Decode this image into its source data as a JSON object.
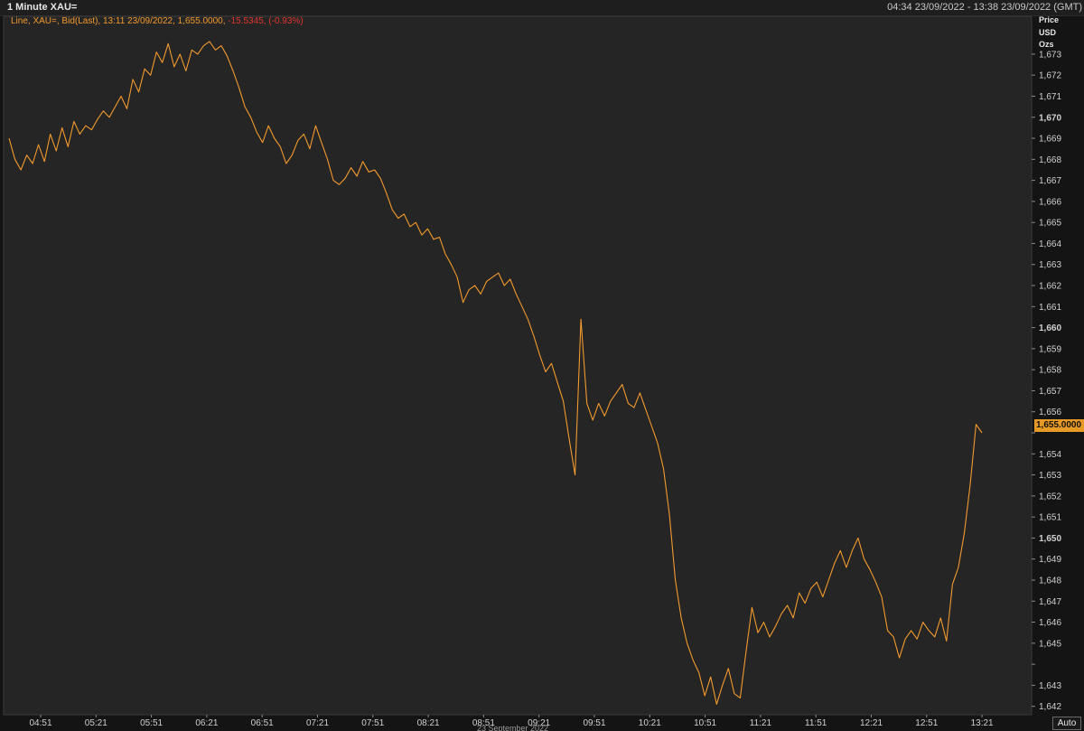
{
  "window": {
    "title": "1 Minute XAU=",
    "time_range": "04:34 23/09/2022 - 13:38 23/09/2022 (GMT)"
  },
  "legend": {
    "main": "Line, XAU=, Bid(Last),  13:11 23/09/2022, 1,655.0000, ",
    "change": "-15.5345, (-0.93%)"
  },
  "axis": {
    "title_lines": [
      "Price",
      "USD",
      "Ozs"
    ],
    "last_price_label": "1,655.0000",
    "auto_label": "Auto",
    "x_footer": "23 September 2022"
  },
  "colors": {
    "background": "#141414",
    "plot": "#252525",
    "grid": "#4a4a4a",
    "line": "#f29a2e",
    "negative": "#e0362b",
    "last_price_tag": "#e79a25"
  },
  "chart_data": {
    "type": "line",
    "title": "1 Minute XAU=",
    "ylabel": "Price USD Ozs",
    "ylim": [
      1641.6,
      1674.8
    ],
    "grid": true,
    "xticks": [
      "04:51",
      "05:21",
      "05:51",
      "06:21",
      "06:51",
      "07:21",
      "07:51",
      "08:21",
      "08:51",
      "09:21",
      "09:51",
      "10:21",
      "10:51",
      "11:21",
      "11:51",
      "12:21",
      "12:51",
      "13:21"
    ],
    "yticks": [
      {
        "v": 1642,
        "label": "1,642"
      },
      {
        "v": 1643,
        "label": "1,643"
      },
      {
        "v": 1644,
        "label": ""
      },
      {
        "v": 1645,
        "label": "1,645"
      },
      {
        "v": 1646,
        "label": "1,646"
      },
      {
        "v": 1647,
        "label": "1,647"
      },
      {
        "v": 1648,
        "label": "1,648"
      },
      {
        "v": 1649,
        "label": "1,649"
      },
      {
        "v": 1650,
        "label": "1,650"
      },
      {
        "v": 1651,
        "label": "1,651"
      },
      {
        "v": 1652,
        "label": "1,652"
      },
      {
        "v": 1653,
        "label": "1,653"
      },
      {
        "v": 1654,
        "label": "1,654"
      },
      {
        "v": 1655,
        "label": ""
      },
      {
        "v": 1656,
        "label": "1,656"
      },
      {
        "v": 1657,
        "label": "1,657"
      },
      {
        "v": 1658,
        "label": "1,658"
      },
      {
        "v": 1659,
        "label": "1,659"
      },
      {
        "v": 1660,
        "label": "1,660"
      },
      {
        "v": 1661,
        "label": "1,661"
      },
      {
        "v": 1662,
        "label": "1,662"
      },
      {
        "v": 1663,
        "label": "1,663"
      },
      {
        "v": 1664,
        "label": "1,664"
      },
      {
        "v": 1665,
        "label": "1,665"
      },
      {
        "v": 1666,
        "label": "1,666"
      },
      {
        "v": 1667,
        "label": "1,667"
      },
      {
        "v": 1668,
        "label": "1,668"
      },
      {
        "v": 1669,
        "label": "1,669"
      },
      {
        "v": 1670,
        "label": "1,670"
      },
      {
        "v": 1671,
        "label": "1,671"
      },
      {
        "v": 1672,
        "label": "1,672"
      },
      {
        "v": 1673,
        "label": "1,673"
      }
    ],
    "bold_ticks": [
      1650,
      1660,
      1670
    ],
    "series": [
      {
        "x_start": "04:34",
        "x_end": "13:11",
        "values": [
          1669.0,
          1668.0,
          1667.5,
          1668.2,
          1667.8,
          1668.7,
          1667.9,
          1669.2,
          1668.4,
          1669.5,
          1668.6,
          1669.8,
          1669.2,
          1669.6,
          1669.4,
          1669.9,
          1670.3,
          1670.0,
          1670.5,
          1671.0,
          1670.4,
          1671.8,
          1671.2,
          1672.3,
          1672.0,
          1673.1,
          1672.6,
          1673.5,
          1672.4,
          1673.0,
          1672.2,
          1673.2,
          1673.0,
          1673.4,
          1673.6,
          1673.2,
          1673.4,
          1672.9,
          1672.2,
          1671.4,
          1670.5,
          1670.0,
          1669.3,
          1668.8,
          1669.6,
          1669.0,
          1668.6,
          1667.8,
          1668.2,
          1668.9,
          1669.2,
          1668.5,
          1669.6,
          1668.8,
          1668.0,
          1667.0,
          1666.8,
          1667.1,
          1667.6,
          1667.2,
          1667.9,
          1667.4,
          1667.5,
          1667.1,
          1666.4,
          1665.6,
          1665.2,
          1665.4,
          1664.8,
          1665.0,
          1664.4,
          1664.7,
          1664.2,
          1664.3,
          1663.5,
          1663.0,
          1662.4,
          1661.2,
          1661.8,
          1662.0,
          1661.6,
          1662.2,
          1662.4,
          1662.6,
          1662.0,
          1662.3,
          1661.6,
          1661.0,
          1660.4,
          1659.6,
          1658.7,
          1657.9,
          1658.3,
          1657.4,
          1656.5,
          1654.7,
          1653.0,
          1660.4,
          1656.4,
          1655.6,
          1656.4,
          1655.8,
          1656.5,
          1656.9,
          1657.3,
          1656.4,
          1656.2,
          1656.9,
          1656.1,
          1655.3,
          1654.5,
          1653.3,
          1651.1,
          1648.0,
          1646.2,
          1645.0,
          1644.2,
          1643.6,
          1642.5,
          1643.4,
          1642.1,
          1643.0,
          1643.8,
          1642.6,
          1642.4,
          1644.6,
          1646.7,
          1645.5,
          1646.0,
          1645.3,
          1645.8,
          1646.4,
          1646.8,
          1646.2,
          1647.4,
          1646.9,
          1647.6,
          1647.9,
          1647.2,
          1648.0,
          1648.8,
          1649.4,
          1648.6,
          1649.4,
          1650.0,
          1649.0,
          1648.5,
          1647.9,
          1647.2,
          1645.6,
          1645.3,
          1644.3,
          1645.2,
          1645.6,
          1645.2,
          1646.0,
          1645.6,
          1645.3,
          1646.2,
          1645.1,
          1647.8,
          1648.6,
          1650.2,
          1652.5,
          1655.4,
          1655.0
        ]
      }
    ]
  }
}
